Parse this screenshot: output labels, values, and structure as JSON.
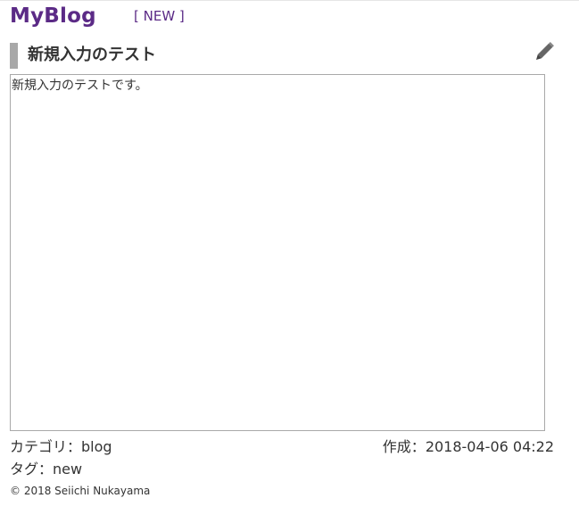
{
  "header": {
    "brand": "MyBlog",
    "new_link": "[ NEW ]"
  },
  "post": {
    "title": "新規入力のテスト",
    "edit_icon": "pencil-icon",
    "body": "新規入力のテストです。",
    "category_label": "カテゴリ：",
    "category_value": "blog",
    "created_label": "作成：",
    "created_value": "2018-04-06 04:22",
    "tag_label": "タグ：",
    "tag_value": "new"
  },
  "footer": {
    "copyright": "© 2018 Seiichi Nukayama"
  },
  "colors": {
    "brand": "#5b2a86",
    "title_bar": "#a8a8a8",
    "text": "#333333",
    "border": "#a9a9a9"
  }
}
